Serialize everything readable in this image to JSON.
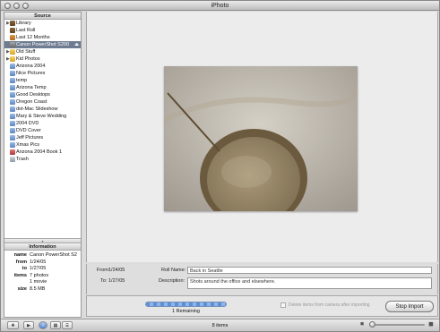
{
  "window": {
    "title": "iPhoto"
  },
  "source": {
    "header": "Source",
    "items": [
      {
        "label": "Library",
        "icon": "library-icon",
        "kind": "roll",
        "disclosure": "▶"
      },
      {
        "label": "Last Roll",
        "icon": "last-roll-icon",
        "kind": "roll",
        "disclosure": ""
      },
      {
        "label": "Last 12 Months",
        "icon": "calendar-icon",
        "kind": "cal",
        "disclosure": ""
      },
      {
        "label": "Canon PowerShot S200",
        "icon": "camera-icon",
        "kind": "camera",
        "disclosure": "",
        "selected": true
      },
      {
        "label": "Old Stuff",
        "icon": "folder-icon",
        "kind": "folder",
        "disclosure": "▶"
      },
      {
        "label": "Kid Photos",
        "icon": "folder-icon",
        "kind": "folder",
        "disclosure": "▶"
      },
      {
        "label": "Arizona 2004",
        "icon": "album-icon",
        "kind": "album",
        "disclosure": ""
      },
      {
        "label": "Nice Pictures",
        "icon": "album-icon",
        "kind": "album",
        "disclosure": ""
      },
      {
        "label": "temp",
        "icon": "album-icon",
        "kind": "album",
        "disclosure": ""
      },
      {
        "label": "Arizona Temp",
        "icon": "album-icon",
        "kind": "album",
        "disclosure": ""
      },
      {
        "label": "Good Desktops",
        "icon": "album-icon",
        "kind": "album",
        "disclosure": ""
      },
      {
        "label": "Oregon Coast",
        "icon": "album-icon",
        "kind": "album",
        "disclosure": ""
      },
      {
        "label": "dot-Mac Slideshow",
        "icon": "album-icon",
        "kind": "album",
        "disclosure": ""
      },
      {
        "label": "Mary & Steve Wedding",
        "icon": "album-icon",
        "kind": "album",
        "disclosure": ""
      },
      {
        "label": "2004 DVD",
        "icon": "album-icon",
        "kind": "album",
        "disclosure": ""
      },
      {
        "label": "DVD Cover",
        "icon": "album-icon",
        "kind": "album",
        "disclosure": ""
      },
      {
        "label": "Jeff Pictures",
        "icon": "album-icon",
        "kind": "album",
        "disclosure": ""
      },
      {
        "label": "Xmas Pics",
        "icon": "album-icon",
        "kind": "album",
        "disclosure": ""
      },
      {
        "label": "Arizona 2004 Book 1",
        "icon": "book-icon",
        "kind": "book",
        "disclosure": ""
      },
      {
        "label": "Trash",
        "icon": "trash-icon",
        "kind": "trash",
        "disclosure": ""
      }
    ]
  },
  "info": {
    "header": "Information",
    "rows": [
      {
        "label": "name",
        "value": "Canon PowerShot S2..."
      },
      {
        "label": "from",
        "value": "1/24/05"
      },
      {
        "label": "to",
        "value": "1/27/05"
      },
      {
        "label": "items",
        "value": "7 photos"
      },
      {
        "label": "",
        "value": "1 movie"
      },
      {
        "label": "size",
        "value": "8.5 MB"
      }
    ]
  },
  "import_form": {
    "from_label": "From:",
    "from_value": "1/24/05",
    "to_label": "To:",
    "to_value": "1/27/05",
    "roll_name_label": "Roll Name:",
    "roll_name_value": "Back in Seattle",
    "description_label": "Description:",
    "description_value": "Shots around the office and elsewhere."
  },
  "import": {
    "progress": 1.0,
    "remaining": "1 Remaining",
    "delete_label": "Delete items from camera after importing",
    "stop_label": "Stop Import"
  },
  "toolbar": {
    "item_count": "8 items",
    "buttons": [
      "add-icon",
      "play-icon",
      "info-icon",
      "calendar-view-icon",
      "keyword-icon"
    ],
    "info_glyph": "i",
    "zoom_level": 0
  }
}
